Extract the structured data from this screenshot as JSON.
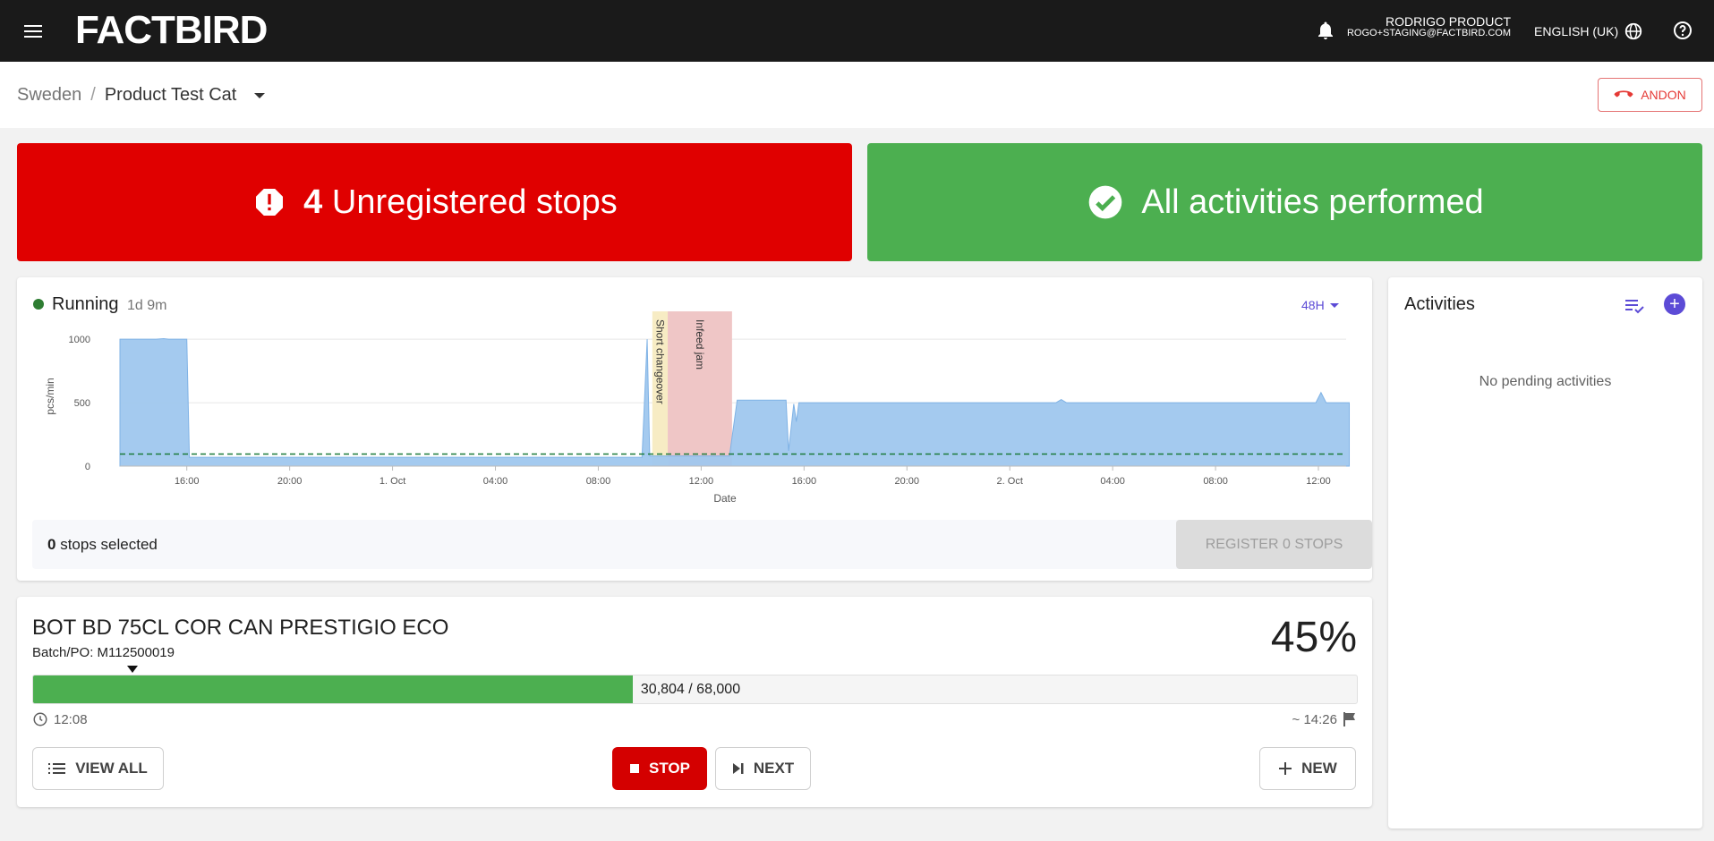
{
  "header": {
    "logo": "FACTBIRD",
    "user_name": "RODRIGO PRODUCT",
    "user_email": "ROGO+STAGING@FACTBIRD.COM",
    "language": "ENGLISH (UK)",
    "icons": [
      "menu-icon",
      "bell-icon",
      "globe-icon",
      "help-icon"
    ]
  },
  "breadcrumb": {
    "parent": "Sweden",
    "separator": "/",
    "current": "Product Test Cat",
    "andon_label": "ANDON"
  },
  "banners": {
    "stops_count": "4",
    "stops_label": "Unregistered stops",
    "activities_label": "All activities performed",
    "colors": {
      "stops": "#e00000",
      "activities": "#4caf50"
    }
  },
  "status": {
    "label": "Running",
    "duration": "1d 9m",
    "range": "48H",
    "color": "#2e7d32"
  },
  "chart_data": {
    "type": "area",
    "xlabel": "Date",
    "ylabel": "pcs/min",
    "ylim": [
      0,
      1100
    ],
    "yticks": [
      0,
      500,
      1000
    ],
    "x_tick_labels": [
      "16:00",
      "20:00",
      "1. Oct",
      "04:00",
      "08:00",
      "12:00",
      "16:00",
      "20:00",
      "2. Oct",
      "04:00",
      "08:00",
      "12:00"
    ],
    "x_tick_hours": [
      16,
      20,
      24,
      28,
      32,
      36,
      40,
      44,
      48,
      52,
      56,
      60
    ],
    "x_range_hours": [
      13.4,
      61.6
    ],
    "series": [
      {
        "points": [
          [
            13.4,
            1000
          ],
          [
            14.8,
            1000
          ],
          [
            15.1,
            1005
          ],
          [
            15.3,
            1000
          ],
          [
            16.0,
            1000
          ],
          [
            16.1,
            70
          ],
          [
            33.7,
            70
          ],
          [
            33.9,
            1000
          ],
          [
            34.0,
            80
          ],
          [
            37.1,
            80
          ],
          [
            37.4,
            520
          ],
          [
            39.3,
            520
          ],
          [
            39.4,
            120
          ],
          [
            39.6,
            490
          ],
          [
            39.7,
            350
          ],
          [
            39.8,
            500
          ],
          [
            49.8,
            500
          ],
          [
            50.0,
            525
          ],
          [
            50.2,
            500
          ],
          [
            59.9,
            500
          ],
          [
            60.1,
            580
          ],
          [
            60.3,
            500
          ],
          [
            61.2,
            500
          ]
        ],
        "color": "#9fc7ee"
      }
    ],
    "target_line": 95,
    "bands": [
      {
        "label": "Short changeover",
        "x0": 34.1,
        "x1": 34.7,
        "color": "#f7ecc4"
      },
      {
        "label": "Infeed jam",
        "x0": 34.7,
        "x1": 37.2,
        "color": "#efc6c6"
      }
    ],
    "grid": true
  },
  "selection": {
    "count": "0",
    "label": "stops selected",
    "register_label": "REGISTER 0 STOPS"
  },
  "activities": {
    "title": "Activities",
    "empty": "No pending activities"
  },
  "order": {
    "product": "BOT BD 75CL COR CAN PRESTIGIO ECO",
    "batch": "Batch/PO: M112500019",
    "percent": "45%",
    "progress": 0.453,
    "count_text": "30,804 / 68,000",
    "start_time": "12:08",
    "end_time": "~ 14:26",
    "view_all": "VIEW ALL",
    "stop": "STOP",
    "next": "NEXT",
    "new": "NEW"
  }
}
